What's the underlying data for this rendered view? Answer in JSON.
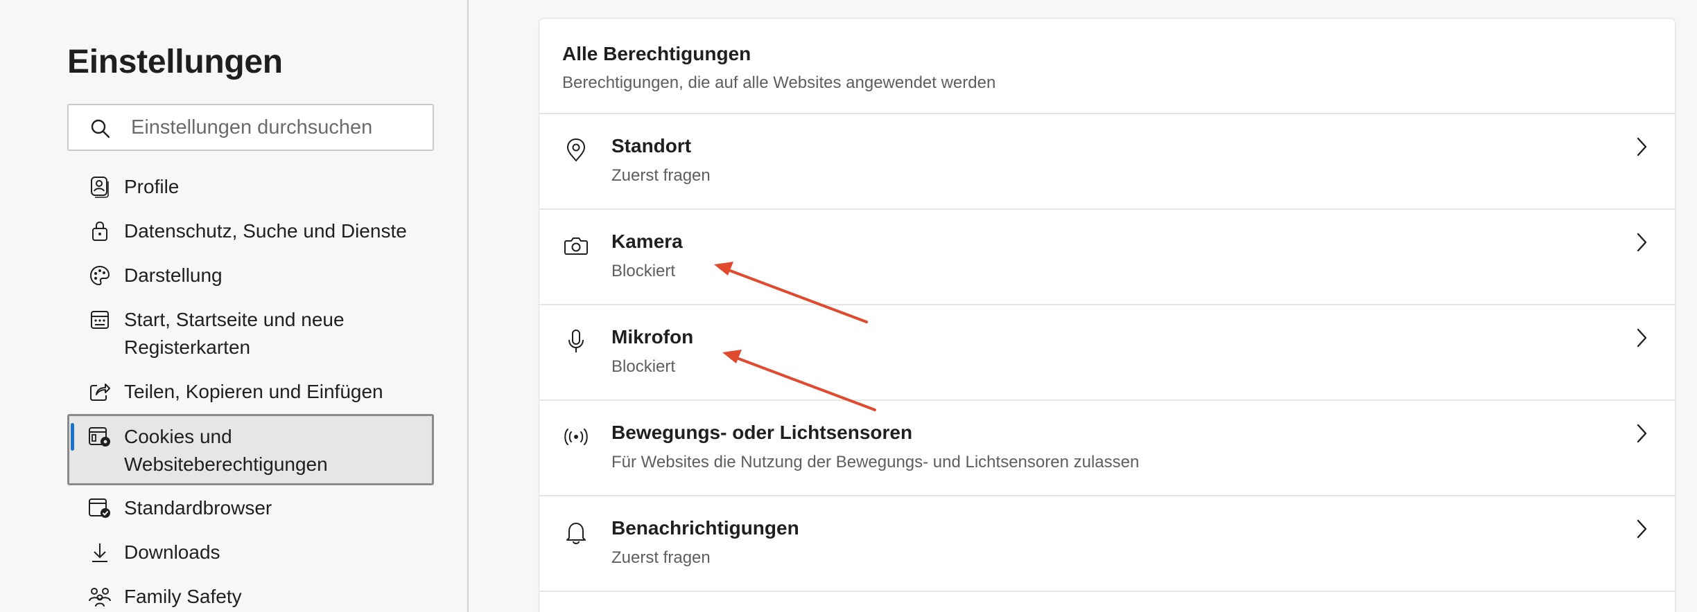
{
  "sidebar": {
    "title": "Einstellungen",
    "search_placeholder": "Einstellungen durchsuchen",
    "items": [
      {
        "label": "Profile",
        "icon": "profile-icon"
      },
      {
        "label": "Datenschutz, Suche und Dienste",
        "icon": "lock-icon"
      },
      {
        "label": "Darstellung",
        "icon": "palette-icon"
      },
      {
        "label": "Start, Startseite und neue Registerkarten",
        "icon": "home-tabs-icon"
      },
      {
        "label": "Teilen, Kopieren und Einfügen",
        "icon": "share-icon"
      },
      {
        "label": "Cookies und Websiteberechtigungen",
        "icon": "cookies-permissions-icon",
        "active": true
      },
      {
        "label": "Standardbrowser",
        "icon": "default-browser-icon"
      },
      {
        "label": "Downloads",
        "icon": "download-icon"
      },
      {
        "label": "Family Safety",
        "icon": "family-icon"
      }
    ]
  },
  "main": {
    "section_title": "Alle Berechtigungen",
    "section_subtitle": "Berechtigungen, die auf alle Websites angewendet werden",
    "permissions": [
      {
        "title": "Standort",
        "status": "Zuerst fragen",
        "icon": "location-icon"
      },
      {
        "title": "Kamera",
        "status": "Blockiert",
        "icon": "camera-icon"
      },
      {
        "title": "Mikrofon",
        "status": "Blockiert",
        "icon": "microphone-icon"
      },
      {
        "title": "Bewegungs- oder Lichtsensoren",
        "status": "Für Websites die Nutzung der Bewegungs- und Lichtsensoren zulassen",
        "icon": "sensor-icon"
      },
      {
        "title": "Benachrichtigungen",
        "status": "Zuerst fragen",
        "icon": "bell-icon"
      }
    ]
  },
  "colors": {
    "active_indicator": "#1a73c9",
    "annotation_arrow": "#e04a2f"
  }
}
